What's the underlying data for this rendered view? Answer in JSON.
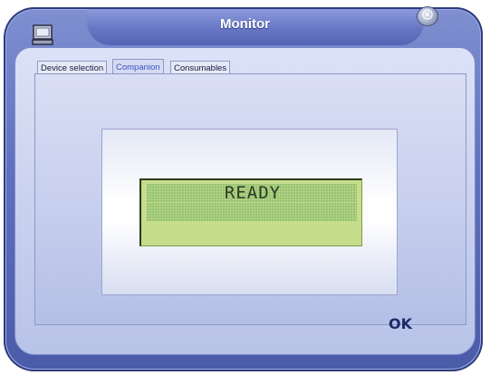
{
  "window": {
    "title": "Monitor"
  },
  "tabs": [
    {
      "label": "Device selection"
    },
    {
      "label": "Companion"
    },
    {
      "label": "Consumables"
    }
  ],
  "lcd": {
    "status_text": "READY",
    "color": "#c6dd8c"
  },
  "footer": {
    "ok_label": "OK"
  },
  "icons": {
    "app": "monitor-icon",
    "close": "close-icon"
  },
  "colors": {
    "frame": "#5f71bd",
    "active_tab_text": "#3a50c0"
  }
}
